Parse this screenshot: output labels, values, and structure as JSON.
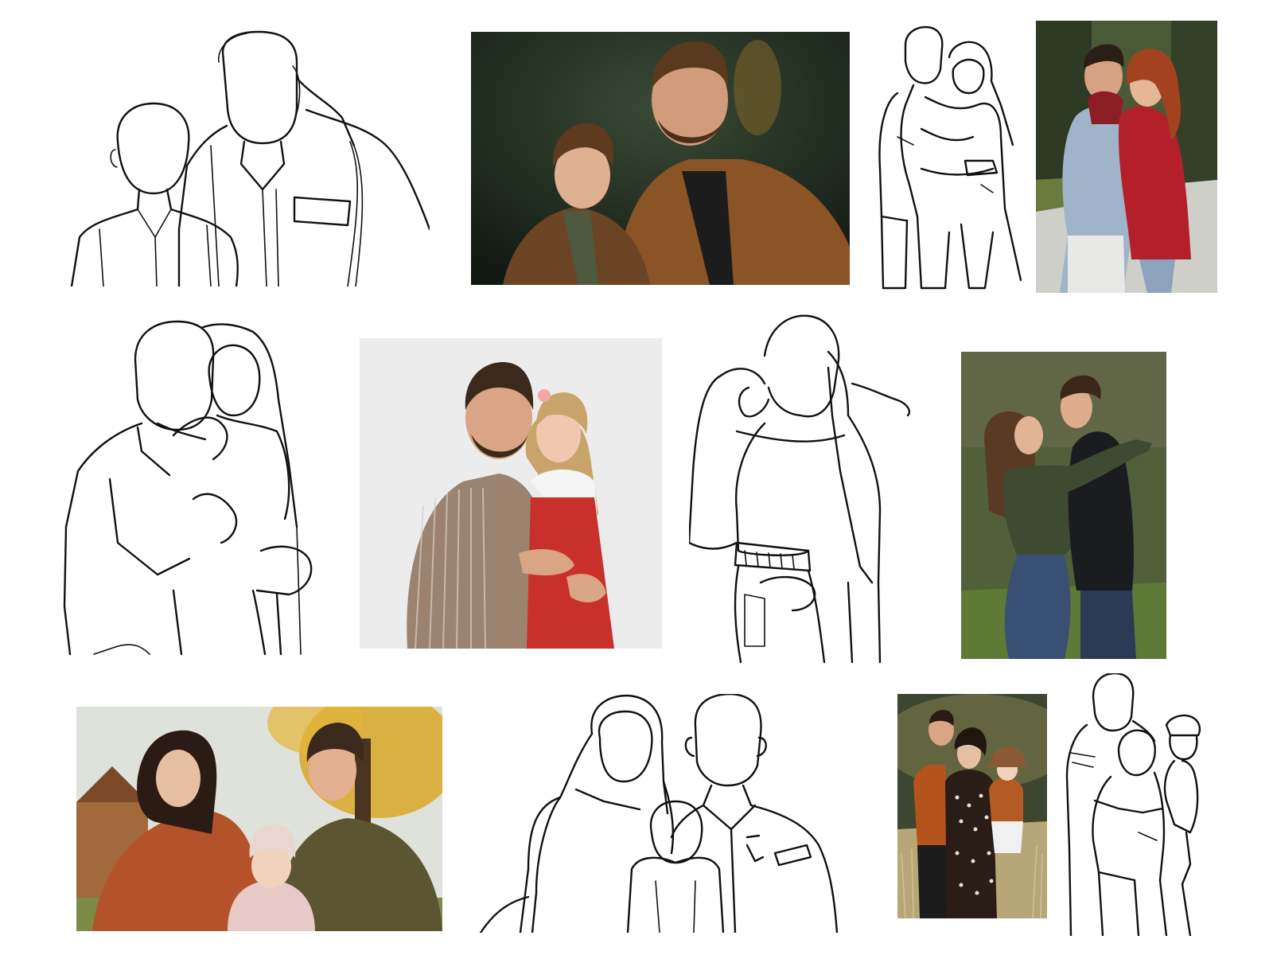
{
  "gallery": {
    "palette": {
      "line_color": "#111111",
      "photo_dark_forest": "#1f2a22",
      "jacket_brown": "#8a5424",
      "red_coat": "#b3202a",
      "denim": "#9fb4c8",
      "studio_white": "#e9e9e9",
      "overalls_red": "#c9302c",
      "olive_jacket": "#3f4a33",
      "leather_black": "#1b1c1f",
      "autumn_yellow": "#d9a727",
      "puffer_orange": "#b4532a",
      "puffer_olive": "#5b5532"
    },
    "panels": [
      {
        "kind": "line-drawing",
        "subject": "father-and-son",
        "icon": "line-art-icon"
      },
      {
        "kind": "photo",
        "subject": "father-and-son",
        "icon": "photo-icon"
      },
      {
        "kind": "line-drawing",
        "subject": "couple-hug",
        "icon": "line-art-icon"
      },
      {
        "kind": "photo",
        "subject": "couple-hug",
        "icon": "photo-icon"
      },
      {
        "kind": "line-drawing",
        "subject": "father-and-daughter",
        "icon": "line-art-icon"
      },
      {
        "kind": "photo",
        "subject": "father-and-daughter",
        "icon": "photo-icon"
      },
      {
        "kind": "line-drawing",
        "subject": "couple-kiss",
        "icon": "line-art-icon"
      },
      {
        "kind": "photo",
        "subject": "couple-kiss",
        "icon": "photo-icon"
      },
      {
        "kind": "photo",
        "subject": "family-with-toddler",
        "icon": "photo-icon"
      },
      {
        "kind": "line-drawing",
        "subject": "family-with-toddler",
        "icon": "line-art-icon"
      },
      {
        "kind": "photo",
        "subject": "family-with-baby",
        "icon": "photo-icon"
      },
      {
        "kind": "line-drawing",
        "subject": "family-with-baby",
        "icon": "line-art-icon"
      }
    ]
  }
}
